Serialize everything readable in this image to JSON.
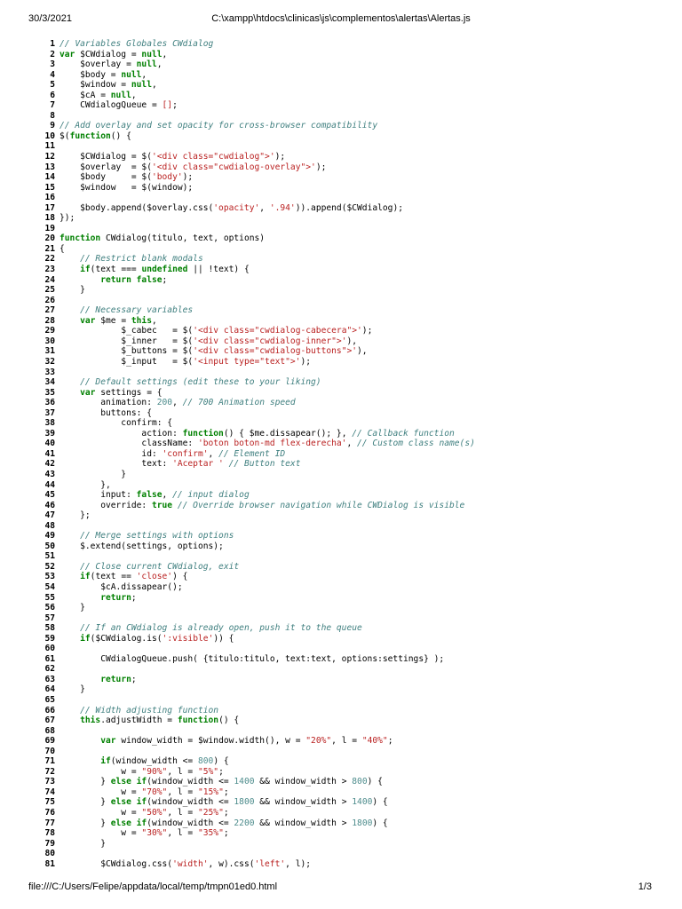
{
  "header": {
    "date": "30/3/2021",
    "path": "C:\\xampp\\htdocs\\clinicas\\js\\complementos\\alertas\\Alertas.js"
  },
  "footer": {
    "url": "file:///C:/Users/Felipe/appdata/local/temp/tmpn01ed0.html",
    "page": "1/3"
  },
  "code": [
    [
      [
        "c",
        "// Variables Globales CWdialog"
      ]
    ],
    [
      [
        "k",
        "var"
      ],
      [
        "t",
        " $CWdialog = "
      ],
      [
        "k",
        "null"
      ],
      [
        "t",
        ","
      ]
    ],
    [
      [
        "t",
        "    $overlay = "
      ],
      [
        "k",
        "null"
      ],
      [
        "t",
        ","
      ]
    ],
    [
      [
        "t",
        "    $body = "
      ],
      [
        "k",
        "null"
      ],
      [
        "t",
        ","
      ]
    ],
    [
      [
        "t",
        "    $window = "
      ],
      [
        "k",
        "null"
      ],
      [
        "t",
        ","
      ]
    ],
    [
      [
        "t",
        "    $cA = "
      ],
      [
        "k",
        "null"
      ],
      [
        "t",
        ","
      ]
    ],
    [
      [
        "t",
        "    CWdialogQueue = "
      ],
      [
        "s",
        "[]"
      ],
      [
        "t",
        ";"
      ]
    ],
    [],
    [
      [
        "c",
        "// Add overlay and set opacity for cross-browser compatibility"
      ]
    ],
    [
      [
        "t",
        "$("
      ],
      [
        "k",
        "function"
      ],
      [
        "t",
        "() {"
      ]
    ],
    [],
    [
      [
        "t",
        "    $CWdialog = $("
      ],
      [
        "s",
        "'<div class=\"cwdialog\">'"
      ],
      [
        "t",
        ");"
      ]
    ],
    [
      [
        "t",
        "    $overlay  = $("
      ],
      [
        "s",
        "'<div class=\"cwdialog-overlay\">'"
      ],
      [
        "t",
        ");"
      ]
    ],
    [
      [
        "t",
        "    $body     = $("
      ],
      [
        "s",
        "'body'"
      ],
      [
        "t",
        ");"
      ]
    ],
    [
      [
        "t",
        "    $window   = $(window);"
      ]
    ],
    [],
    [
      [
        "t",
        "    $body.append($overlay.css("
      ],
      [
        "s",
        "'opacity'"
      ],
      [
        "t",
        ", "
      ],
      [
        "s",
        "'.94'"
      ],
      [
        "t",
        ")).append($CWdialog);"
      ]
    ],
    [
      [
        "t",
        "});"
      ]
    ],
    [],
    [
      [
        "k",
        "function"
      ],
      [
        "t",
        " CWdialog(titulo, text, options)"
      ]
    ],
    [
      [
        "t",
        "{"
      ]
    ],
    [
      [
        "t",
        "    "
      ],
      [
        "c",
        "// Restrict blank modals"
      ]
    ],
    [
      [
        "t",
        "    "
      ],
      [
        "k",
        "if"
      ],
      [
        "t",
        "(text === "
      ],
      [
        "k",
        "undefined"
      ],
      [
        "t",
        " || !text) {"
      ]
    ],
    [
      [
        "t",
        "        "
      ],
      [
        "k",
        "return false"
      ],
      [
        "t",
        ";"
      ]
    ],
    [
      [
        "t",
        "    }"
      ]
    ],
    [],
    [
      [
        "t",
        "    "
      ],
      [
        "c",
        "// Necessary variables"
      ]
    ],
    [
      [
        "t",
        "    "
      ],
      [
        "k",
        "var"
      ],
      [
        "t",
        " $me = "
      ],
      [
        "k",
        "this"
      ],
      [
        "t",
        ","
      ]
    ],
    [
      [
        "t",
        "            $_cabec   = $("
      ],
      [
        "s",
        "'<div class=\"cwdialog-cabecera\">'"
      ],
      [
        "t",
        ");"
      ]
    ],
    [
      [
        "t",
        "            $_inner   = $("
      ],
      [
        "s",
        "'<div class=\"cwdialog-inner\">'"
      ],
      [
        "t",
        "),"
      ]
    ],
    [
      [
        "t",
        "            $_buttons = $("
      ],
      [
        "s",
        "'<div class=\"cwdialog-buttons\">'"
      ],
      [
        "t",
        "),"
      ]
    ],
    [
      [
        "t",
        "            $_input   = $("
      ],
      [
        "s",
        "'<input type=\"text\">'"
      ],
      [
        "t",
        ");"
      ]
    ],
    [],
    [
      [
        "t",
        "    "
      ],
      [
        "c",
        "// Default settings (edit these to your liking)"
      ]
    ],
    [
      [
        "t",
        "    "
      ],
      [
        "k",
        "var"
      ],
      [
        "t",
        " settings = {"
      ]
    ],
    [
      [
        "t",
        "        animation: "
      ],
      [
        "n",
        "200"
      ],
      [
        "t",
        ", "
      ],
      [
        "c",
        "// 700 Animation speed"
      ]
    ],
    [
      [
        "t",
        "        buttons: {"
      ]
    ],
    [
      [
        "t",
        "            confirm: {"
      ]
    ],
    [
      [
        "t",
        "                action: "
      ],
      [
        "k",
        "function"
      ],
      [
        "t",
        "() { $me.dissapear(); }, "
      ],
      [
        "c",
        "// Callback function"
      ]
    ],
    [
      [
        "t",
        "                className: "
      ],
      [
        "s",
        "'boton boton-md flex-derecha'"
      ],
      [
        "t",
        ", "
      ],
      [
        "c",
        "// Custom class name(s)"
      ]
    ],
    [
      [
        "t",
        "                id: "
      ],
      [
        "s",
        "'confirm'"
      ],
      [
        "t",
        ", "
      ],
      [
        "c",
        "// Element ID"
      ]
    ],
    [
      [
        "t",
        "                text: "
      ],
      [
        "s",
        "'Aceptar '"
      ],
      [
        "t",
        " "
      ],
      [
        "c",
        "// Button text"
      ]
    ],
    [
      [
        "t",
        "            }"
      ]
    ],
    [
      [
        "t",
        "        },"
      ]
    ],
    [
      [
        "t",
        "        input: "
      ],
      [
        "k",
        "false"
      ],
      [
        "t",
        ", "
      ],
      [
        "c",
        "// input dialog"
      ]
    ],
    [
      [
        "t",
        "        override: "
      ],
      [
        "k",
        "true"
      ],
      [
        "t",
        " "
      ],
      [
        "c",
        "// Override browser navigation while CWDialog is visible"
      ]
    ],
    [
      [
        "t",
        "    };"
      ]
    ],
    [],
    [
      [
        "t",
        "    "
      ],
      [
        "c",
        "// Merge settings with options"
      ]
    ],
    [
      [
        "t",
        "    $.extend(settings, options);"
      ]
    ],
    [],
    [
      [
        "t",
        "    "
      ],
      [
        "c",
        "// Close current CWdialog, exit"
      ]
    ],
    [
      [
        "t",
        "    "
      ],
      [
        "k",
        "if"
      ],
      [
        "t",
        "(text == "
      ],
      [
        "s",
        "'close'"
      ],
      [
        "t",
        ") {"
      ]
    ],
    [
      [
        "t",
        "        $cA.dissapear();"
      ]
    ],
    [
      [
        "t",
        "        "
      ],
      [
        "k",
        "return"
      ],
      [
        "t",
        ";"
      ]
    ],
    [
      [
        "t",
        "    }"
      ]
    ],
    [],
    [
      [
        "t",
        "    "
      ],
      [
        "c",
        "// If an CWdialog is already open, push it to the queue"
      ]
    ],
    [
      [
        "t",
        "    "
      ],
      [
        "k",
        "if"
      ],
      [
        "t",
        "($CWdialog.is("
      ],
      [
        "s",
        "':visible'"
      ],
      [
        "t",
        ")) {"
      ]
    ],
    [],
    [
      [
        "t",
        "        CWdialogQueue.push( {titulo:titulo, text:text, options:settings} );"
      ]
    ],
    [],
    [
      [
        "t",
        "        "
      ],
      [
        "k",
        "return"
      ],
      [
        "t",
        ";"
      ]
    ],
    [
      [
        "t",
        "    }"
      ]
    ],
    [],
    [
      [
        "t",
        "    "
      ],
      [
        "c",
        "// Width adjusting function"
      ]
    ],
    [
      [
        "t",
        "    "
      ],
      [
        "k",
        "this"
      ],
      [
        "t",
        ".adjustWidth = "
      ],
      [
        "k",
        "function"
      ],
      [
        "t",
        "() {"
      ]
    ],
    [],
    [
      [
        "t",
        "        "
      ],
      [
        "k",
        "var"
      ],
      [
        "t",
        " window_width = $window.width(), w = "
      ],
      [
        "s",
        "\"20%\""
      ],
      [
        "t",
        ", l = "
      ],
      [
        "s",
        "\"40%\""
      ],
      [
        "t",
        ";"
      ]
    ],
    [],
    [
      [
        "t",
        "        "
      ],
      [
        "k",
        "if"
      ],
      [
        "t",
        "(window_width <= "
      ],
      [
        "n",
        "800"
      ],
      [
        "t",
        ") {"
      ]
    ],
    [
      [
        "t",
        "            w = "
      ],
      [
        "s",
        "\"90%\""
      ],
      [
        "t",
        ", l = "
      ],
      [
        "s",
        "\"5%\""
      ],
      [
        "t",
        ";"
      ]
    ],
    [
      [
        "t",
        "        } "
      ],
      [
        "k",
        "else if"
      ],
      [
        "t",
        "(window_width <= "
      ],
      [
        "n",
        "1400"
      ],
      [
        "t",
        " && window_width > "
      ],
      [
        "n",
        "800"
      ],
      [
        "t",
        ") {"
      ]
    ],
    [
      [
        "t",
        "            w = "
      ],
      [
        "s",
        "\"70%\""
      ],
      [
        "t",
        ", l = "
      ],
      [
        "s",
        "\"15%\""
      ],
      [
        "t",
        ";"
      ]
    ],
    [
      [
        "t",
        "        } "
      ],
      [
        "k",
        "else if"
      ],
      [
        "t",
        "(window_width <= "
      ],
      [
        "n",
        "1800"
      ],
      [
        "t",
        " && window_width > "
      ],
      [
        "n",
        "1400"
      ],
      [
        "t",
        ") {"
      ]
    ],
    [
      [
        "t",
        "            w = "
      ],
      [
        "s",
        "\"50%\""
      ],
      [
        "t",
        ", l = "
      ],
      [
        "s",
        "\"25%\""
      ],
      [
        "t",
        ";"
      ]
    ],
    [
      [
        "t",
        "        } "
      ],
      [
        "k",
        "else if"
      ],
      [
        "t",
        "(window_width <= "
      ],
      [
        "n",
        "2200"
      ],
      [
        "t",
        " && window_width > "
      ],
      [
        "n",
        "1800"
      ],
      [
        "t",
        ") {"
      ]
    ],
    [
      [
        "t",
        "            w = "
      ],
      [
        "s",
        "\"30%\""
      ],
      [
        "t",
        ", l = "
      ],
      [
        "s",
        "\"35%\""
      ],
      [
        "t",
        ";"
      ]
    ],
    [
      [
        "t",
        "        }"
      ]
    ],
    [],
    [
      [
        "t",
        "        $CWdialog.css("
      ],
      [
        "s",
        "'width'"
      ],
      [
        "t",
        ", w).css("
      ],
      [
        "s",
        "'left'"
      ],
      [
        "t",
        ", l);"
      ]
    ]
  ]
}
